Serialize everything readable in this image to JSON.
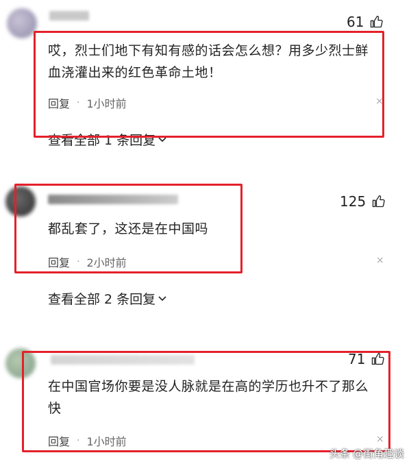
{
  "comments": [
    {
      "likes": "61",
      "text": "哎，烈士们地下有知有感的话会怎么想？用多少烈士鲜血浇灌出来的红色革命土地！",
      "reply_label": "回复",
      "time": "1小时前",
      "view_all": "查看全部 1 条回复"
    },
    {
      "likes": "125",
      "text": "都乱套了，这还是在中国吗",
      "reply_label": "回复",
      "time": "2小时前",
      "view_all": "查看全部 2 条回复"
    },
    {
      "likes": "71",
      "text": "在中国官场你要是没人脉就是在高的学历也升不了那么快",
      "reply_label": "回复",
      "time": "1小时前"
    }
  ],
  "separator": "·",
  "close_glyph": "×",
  "watermark": {
    "platform": "头条",
    "author": "@街角趣谈"
  },
  "colors": {
    "highlight": "#e4202a",
    "text": "#222222",
    "meta": "#666666"
  }
}
